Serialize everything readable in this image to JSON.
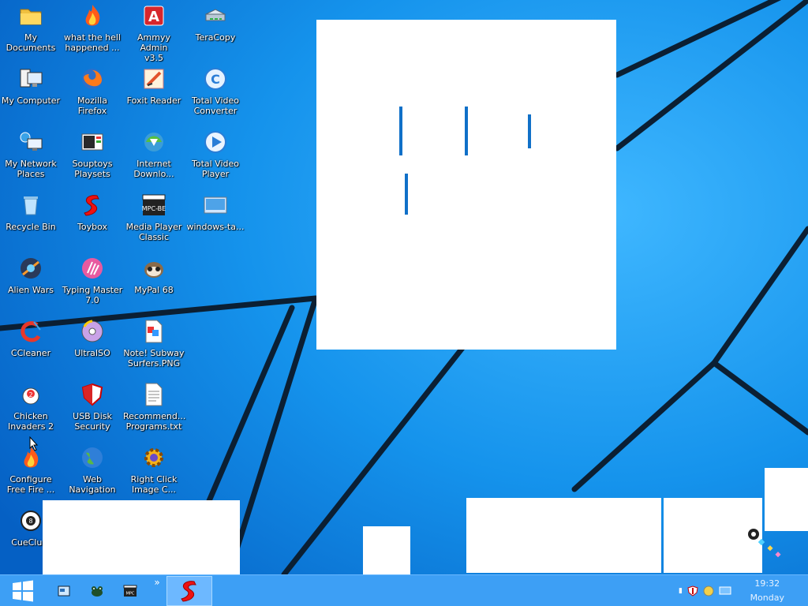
{
  "desktop": {
    "icons": [
      {
        "label": "My\nDocuments",
        "icon": "folder-icon"
      },
      {
        "label": "what the hell\nhappened ...",
        "icon": "fire-icon"
      },
      {
        "label": "Ammyy Admin\nv3.5",
        "icon": "ammyy-icon"
      },
      {
        "label": "TeraCopy",
        "icon": "teracopy-icon"
      },
      {
        "label": "My Computer",
        "icon": "computer-icon"
      },
      {
        "label": "Mozilla\nFirefox",
        "icon": "firefox-icon"
      },
      {
        "label": "Foxit Reader",
        "icon": "foxit-icon"
      },
      {
        "label": "Total Video\nConverter",
        "icon": "video-converter-icon"
      },
      {
        "label": "My Network\nPlaces",
        "icon": "network-icon"
      },
      {
        "label": "Souptoys\nPlaysets",
        "icon": "souptoys-icon"
      },
      {
        "label": "Internet\nDownlo...",
        "icon": "idm-icon"
      },
      {
        "label": "Total Video\nPlayer",
        "icon": "video-player-icon"
      },
      {
        "label": "Recycle Bin",
        "icon": "recycle-bin-icon"
      },
      {
        "label": "Toybox",
        "icon": "toybox-icon"
      },
      {
        "label": "Media Player\nClassic",
        "icon": "mpc-icon"
      },
      {
        "label": "windows-ta...",
        "icon": "image-file-icon"
      },
      {
        "label": "Alien Wars",
        "icon": "alien-wars-icon"
      },
      {
        "label": "Typing Master\n7.0",
        "icon": "typing-master-icon"
      },
      {
        "label": "MyPal 68",
        "icon": "mypal-icon"
      },
      {
        "label": "CCleaner",
        "icon": "ccleaner-icon"
      },
      {
        "label": "UltraISO",
        "icon": "ultraiso-icon"
      },
      {
        "label": "Note! Subway\nSurfers.PNG",
        "icon": "png-file-icon"
      },
      {
        "label": "Chicken\nInvaders 2",
        "icon": "chicken-icon"
      },
      {
        "label": "USB Disk\nSecurity",
        "icon": "shield-icon"
      },
      {
        "label": "Recommend...\nPrograms.txt",
        "icon": "text-file-icon"
      },
      {
        "label": "Configure\nFree Fire ...",
        "icon": "fire-icon"
      },
      {
        "label": "Web\nNavigation",
        "icon": "globe-icon"
      },
      {
        "label": "Right Click\nImage C...",
        "icon": "gear-icon"
      },
      {
        "label": "CueClu...",
        "icon": "cue-icon"
      }
    ]
  },
  "taskbar": {
    "start_icon": "windows-logo-icon",
    "pinned": [
      "window-icon",
      "frog-icon",
      "mpc-icon"
    ],
    "overflow": "»",
    "active_app_icon": "toybox-icon",
    "tray_icons": [
      "arrow-icon",
      "shield-icon",
      "smiley-icon",
      "monitor-icon"
    ],
    "time": "19:32",
    "day": "Monday"
  },
  "colors": {
    "wallpaper": "#0a76d8",
    "taskbar": "#3d9ff5",
    "accent_bar": "#1070c8"
  }
}
